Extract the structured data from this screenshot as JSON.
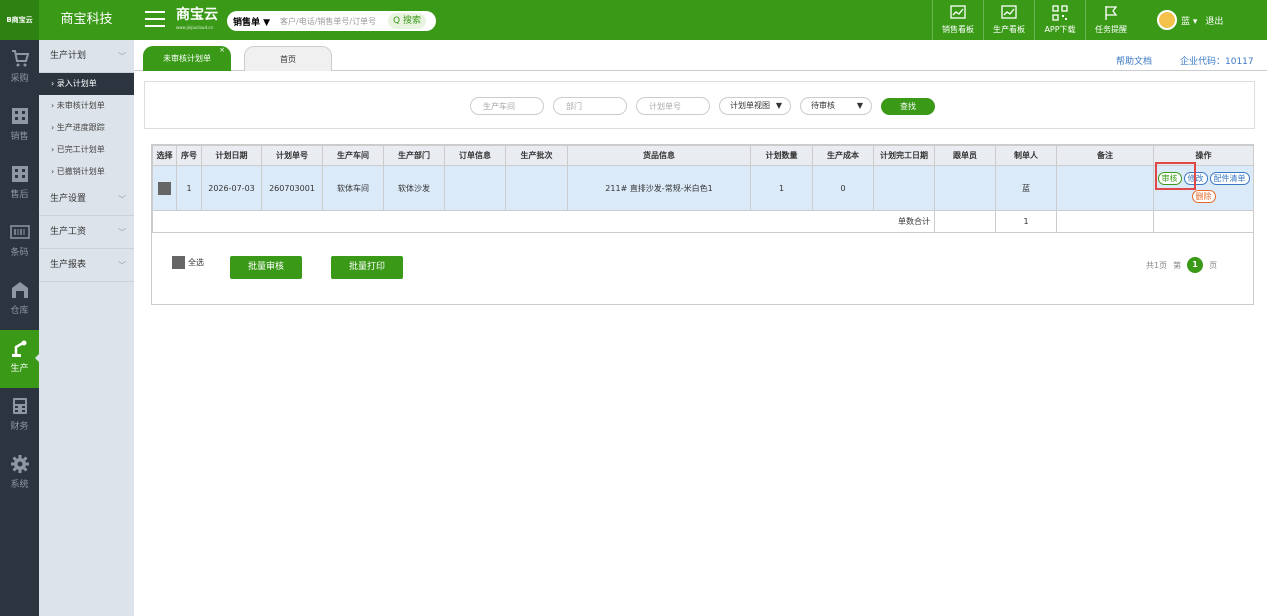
{
  "header": {
    "logo_text": "B商宝云",
    "company": "商宝科技",
    "brand": "商宝云",
    "brand_url": "www.jiejiucloud.cn",
    "search_type": "销售单 ▼",
    "search_placeholder": "客户/电话/销售单号/订单号",
    "search_button": "Q 搜索",
    "tools": [
      "销售看板",
      "生产看板",
      "APP下载",
      "任务提醒"
    ],
    "user": "蓝 ▾",
    "logout": "退出"
  },
  "leftnav": {
    "items": [
      {
        "label": "采购",
        "icon": "cart-icon"
      },
      {
        "label": "销售",
        "icon": "building-icon"
      },
      {
        "label": "售后",
        "icon": "building-icon"
      },
      {
        "label": "条码",
        "icon": "barcode-icon"
      },
      {
        "label": "仓库",
        "icon": "warehouse-icon"
      },
      {
        "label": "生产",
        "icon": "robot-arm-icon"
      },
      {
        "label": "财务",
        "icon": "calculator-icon"
      },
      {
        "label": "系统",
        "icon": "gear-icon"
      }
    ],
    "active": "生产"
  },
  "sidenav": {
    "group1": "生产计划",
    "subitems": [
      "› 录入计划单",
      "› 未审核计划单",
      "› 生产进度跟踪",
      "› 已完工计划单",
      "› 已撤销计划单"
    ],
    "group2": "生产设置",
    "group3": "生产工资",
    "group4": "生产报表"
  },
  "tabs": {
    "active": "未审核计划单",
    "close": "×",
    "home": "首页"
  },
  "links": {
    "help": "帮助文档",
    "corp": "企业代码：10117"
  },
  "filter": {
    "workshop_placeholder": "生产车间",
    "dept_placeholder": "部门",
    "plan_no_placeholder": "计划单号",
    "view_select": "计划单视图",
    "status_select": "待审核",
    "search_button": "查找"
  },
  "table": {
    "headers": [
      "选择",
      "序号",
      "计划日期",
      "计划单号",
      "生产车间",
      "生产部门",
      "订单信息",
      "生产批次",
      "货品信息",
      "计划数量",
      "生产成本",
      "计划完工日期",
      "跟单员",
      "制单人",
      "备注",
      "操作"
    ],
    "rows": [
      {
        "seq": "1",
        "date": "2026-07-03",
        "plan_no": "260703001",
        "workshop": "软体车间",
        "dept": "软体沙发",
        "order_info": "",
        "batch": "",
        "goods": "211# 直排沙发-常规-米白色1",
        "qty": "1",
        "cost": "0",
        "finish_date": "",
        "follower": "",
        "creator": "蓝",
        "remark": ""
      }
    ],
    "ops": {
      "audit": "审核",
      "edit": "修改",
      "parts": "配件清单",
      "delete": "删除"
    },
    "sum_label": "单数合计",
    "sum_value": "1"
  },
  "footer": {
    "select_all": "全选",
    "batch_audit": "批量审核",
    "batch_print": "批量打印",
    "page_info": "共1页",
    "page_prefix": "第",
    "page_current": "1",
    "page_suffix": "页"
  }
}
